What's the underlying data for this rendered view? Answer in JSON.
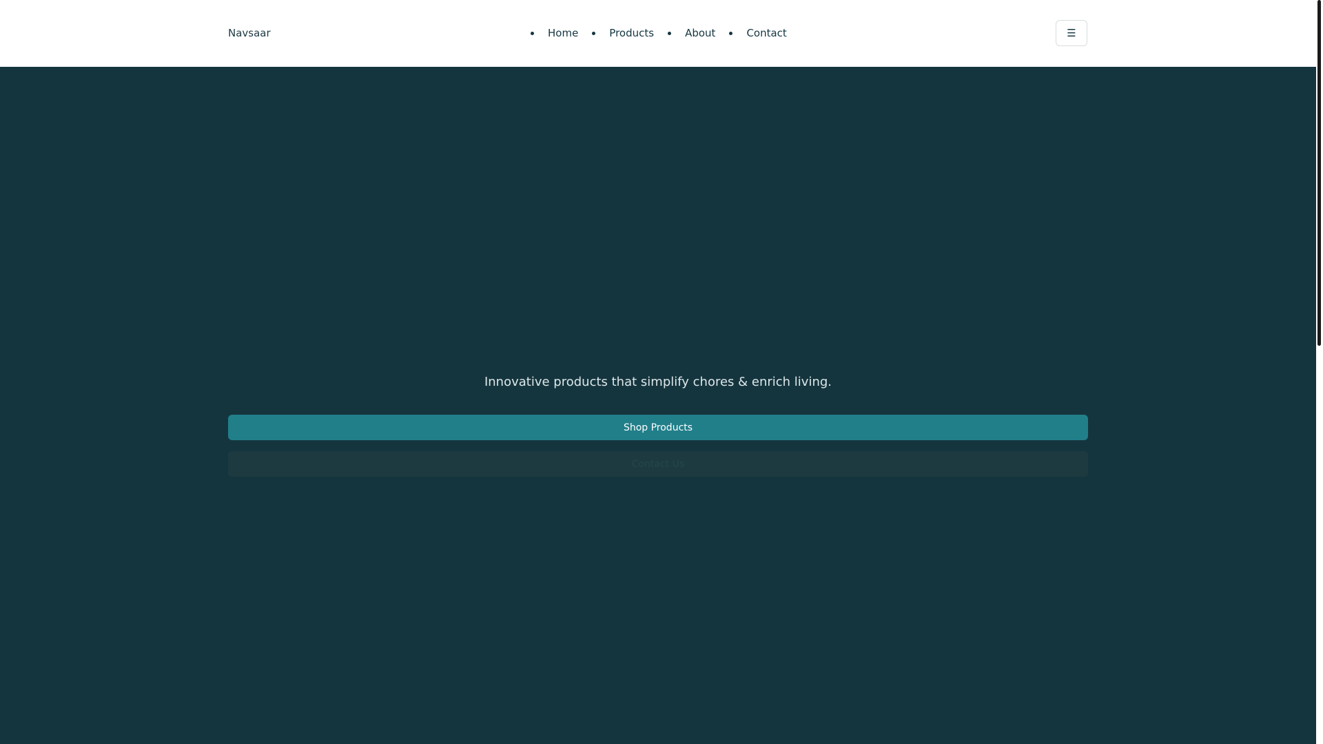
{
  "header": {
    "brand": "Navsaar",
    "nav": [
      {
        "label": "Home"
      },
      {
        "label": "Products"
      },
      {
        "label": "About"
      },
      {
        "label": "Contact"
      }
    ],
    "menu_icon_glyph": "☰",
    "menu_icon": "hamburger-menu-icon"
  },
  "hero": {
    "tagline": "Innovative products that simplify chores & enrich living.",
    "primary_button": "Shop Products",
    "secondary_button": "Contact Us"
  },
  "colors": {
    "hero_background": "#15353e",
    "primary_button": "#217f8a",
    "secondary_button": "#1c3a40",
    "header_background": "#ffffff",
    "text_dark": "#153540"
  }
}
